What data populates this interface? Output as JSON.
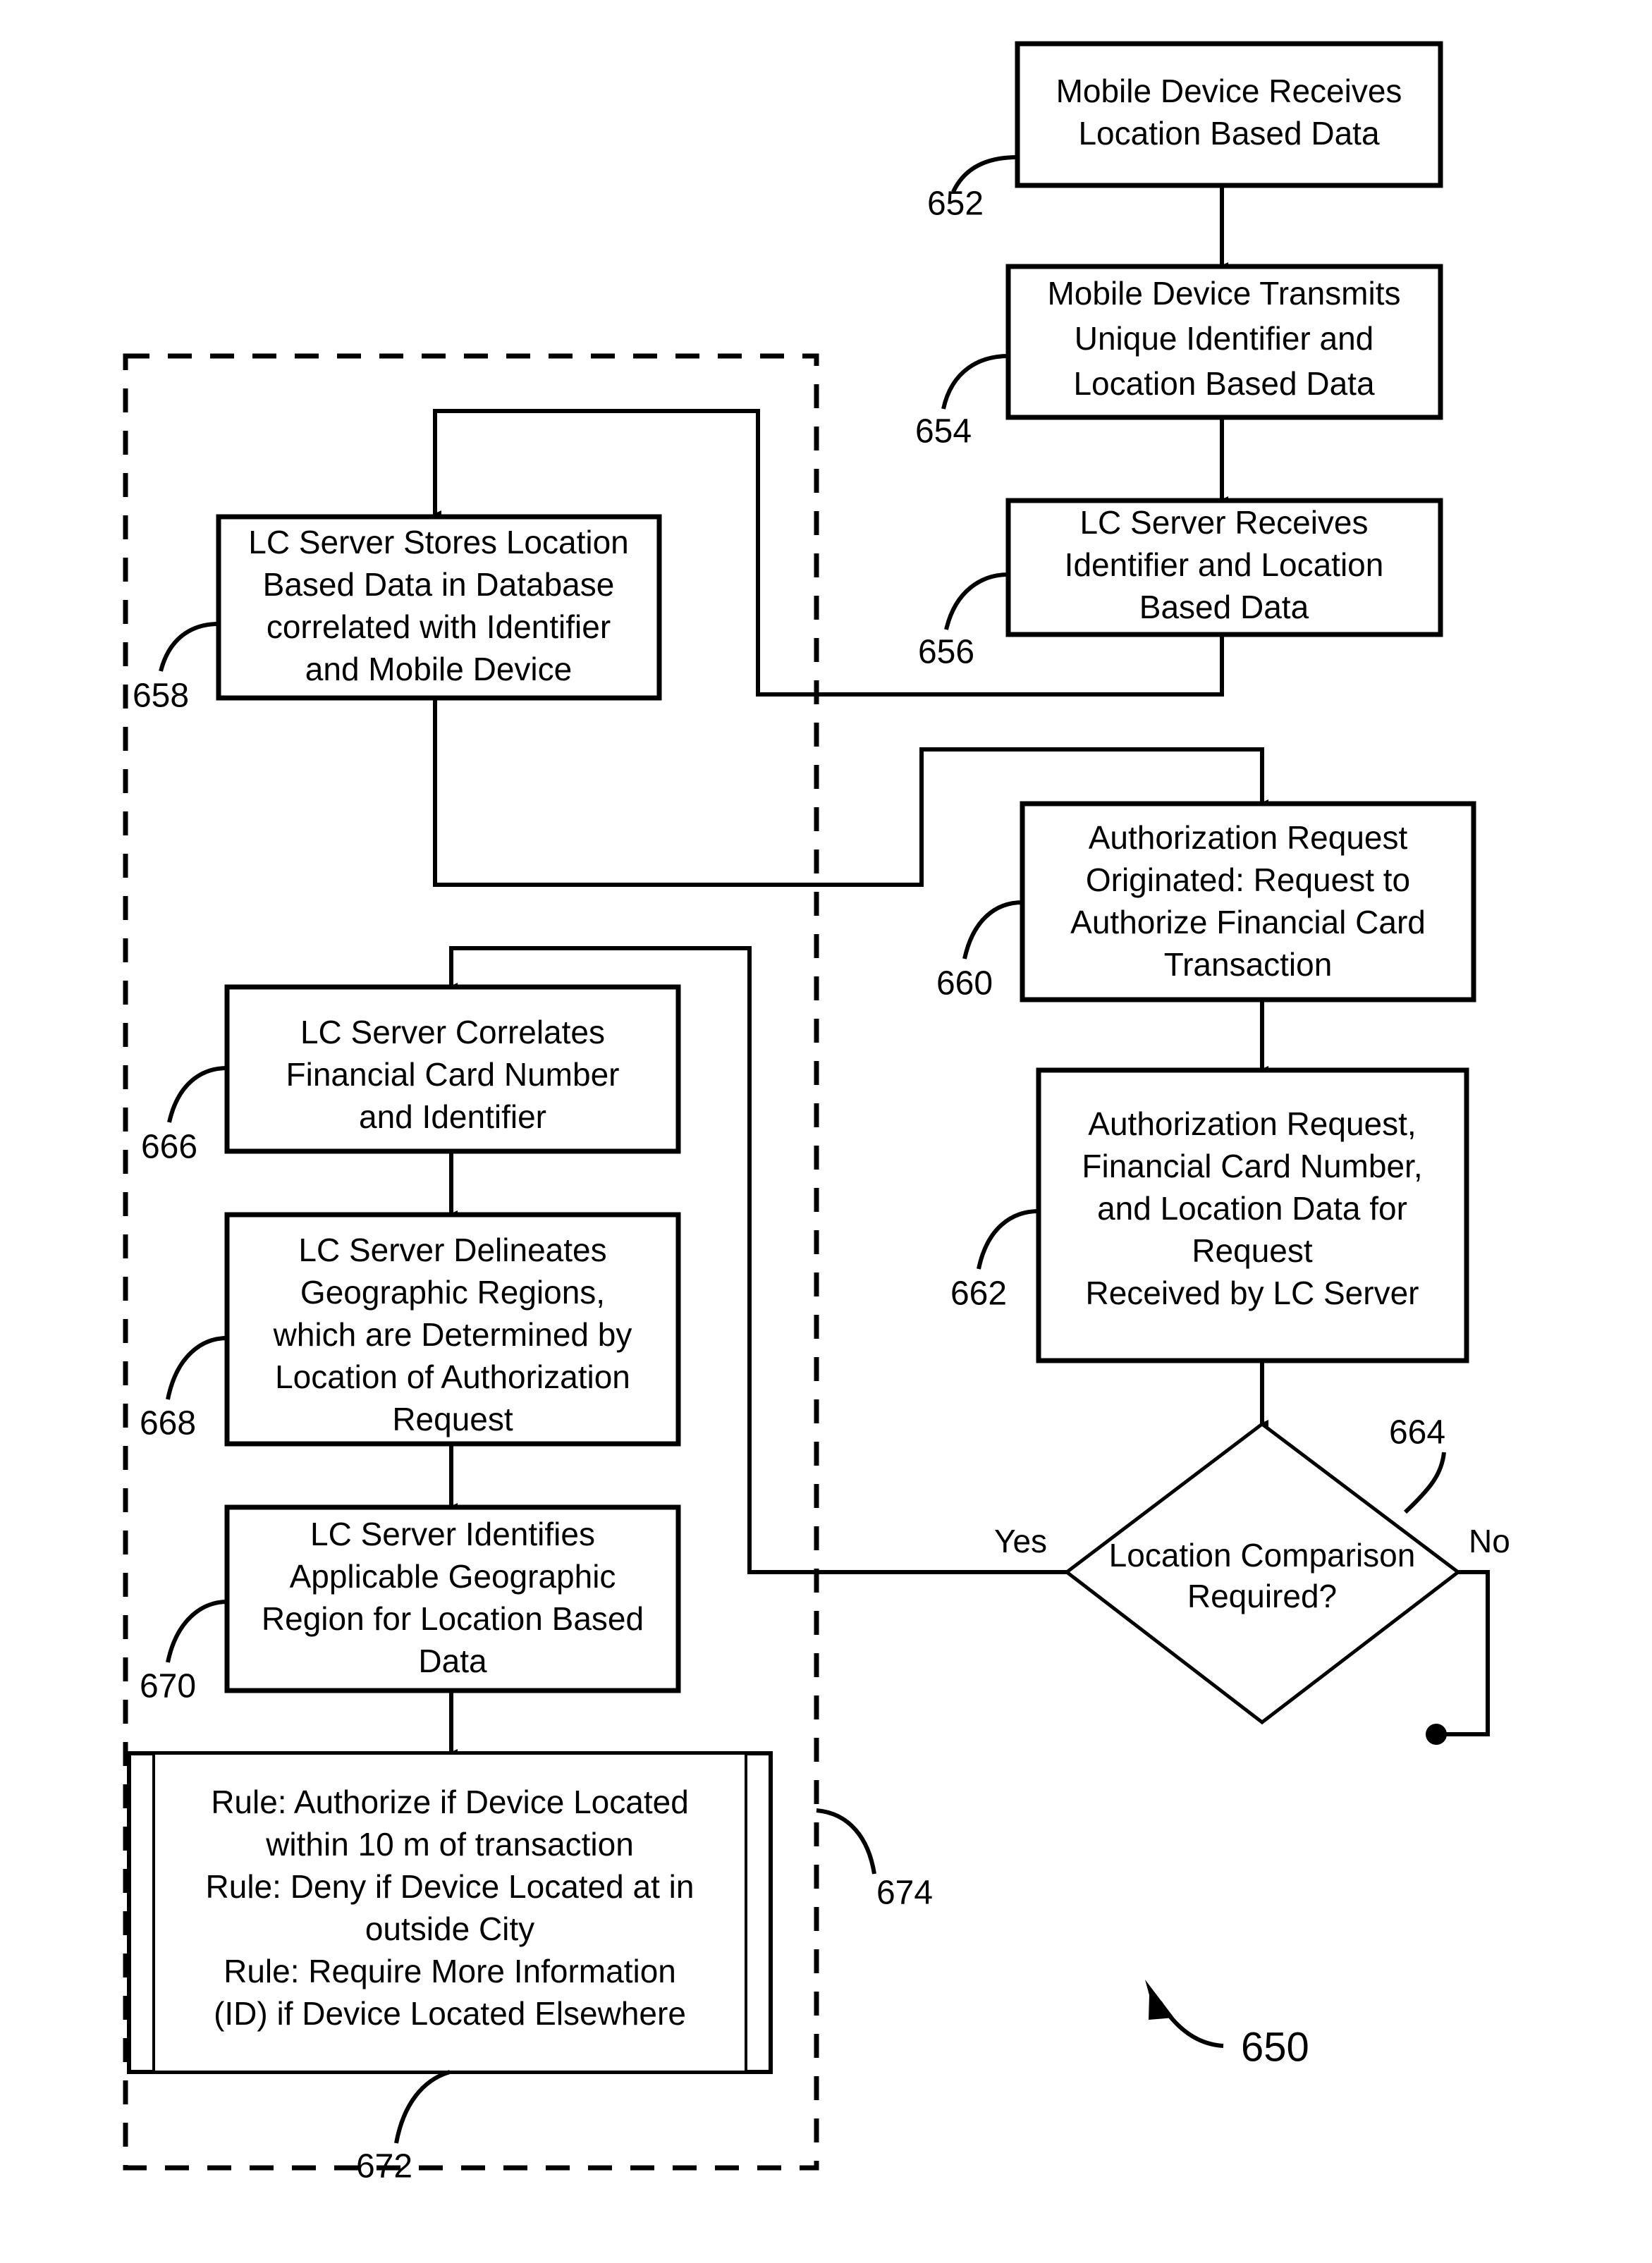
{
  "figure": {
    "figure_number": "650",
    "group_ref": "674",
    "rules_ref": "672"
  },
  "nodes": [
    {
      "id": "n652",
      "ref": "652",
      "type": "process",
      "lines": [
        "Mobile Device Receives",
        "Location Based Data"
      ]
    },
    {
      "id": "n654",
      "ref": "654",
      "type": "process",
      "lines": [
        "Mobile Device Transmits",
        "Unique Identifier and",
        "Location Based Data"
      ]
    },
    {
      "id": "n656",
      "ref": "656",
      "type": "process",
      "lines": [
        "LC Server Receives",
        "Identifier and Location",
        "Based Data"
      ]
    },
    {
      "id": "n658",
      "ref": "658",
      "type": "process",
      "lines": [
        "LC Server Stores Location",
        "Based Data in Database",
        "correlated with Identifier",
        "and Mobile Device"
      ]
    },
    {
      "id": "n660",
      "ref": "660",
      "type": "process",
      "lines": [
        "Authorization Request",
        "Originated: Request to",
        "Authorize Financial Card",
        "Transaction"
      ]
    },
    {
      "id": "n662",
      "ref": "662",
      "type": "process",
      "lines": [
        "Authorization Request,",
        "Financial Card Number,",
        "and Location Data for",
        "Request",
        "Received by LC Server"
      ]
    },
    {
      "id": "n664",
      "ref": "664",
      "type": "decision",
      "lines": [
        "Location Comparison",
        "Required?"
      ],
      "yes_label": "Yes",
      "no_label": "No"
    },
    {
      "id": "n666",
      "ref": "666",
      "type": "process",
      "lines": [
        "LC Server Correlates",
        "Financial Card Number",
        "and Identifier"
      ]
    },
    {
      "id": "n668",
      "ref": "668",
      "type": "process",
      "lines": [
        "LC Server Delineates",
        "Geographic Regions,",
        "which are Determined by",
        "Location of Authorization",
        "Request"
      ]
    },
    {
      "id": "n670",
      "ref": "670",
      "type": "process",
      "lines": [
        "LC Server Identifies",
        "Applicable Geographic",
        "Region for Location Based",
        "Data"
      ]
    },
    {
      "id": "n672",
      "ref": "672",
      "type": "rules",
      "lines": [
        "Rule: Authorize if Device Located",
        "within 10 m of transaction",
        "Rule: Deny if Device Located at in",
        "outside City",
        "Rule: Require More Information",
        "(ID) if Device Located Elsewhere"
      ]
    }
  ]
}
